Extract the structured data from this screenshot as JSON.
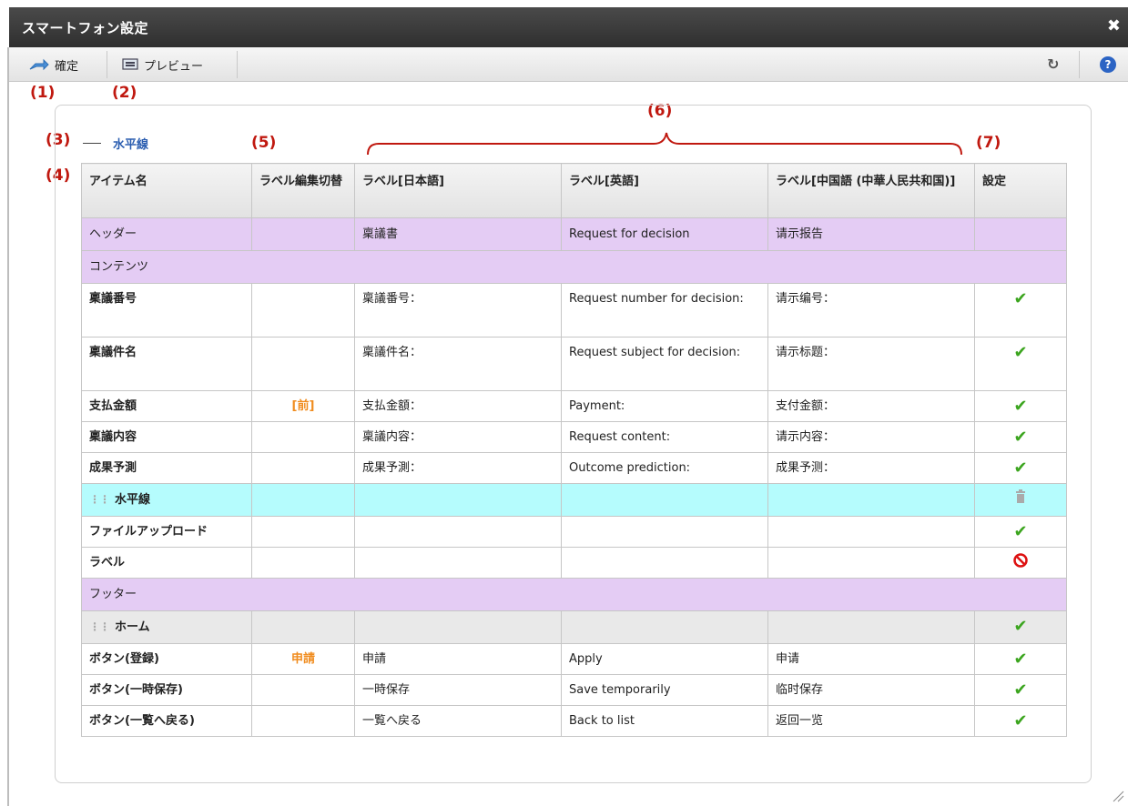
{
  "window": {
    "title": "スマートフォン設定"
  },
  "toolbar": {
    "confirm_label": "確定",
    "preview_label": "プレビュー"
  },
  "annotations": {
    "a1": "(1)",
    "a2": "(2)",
    "a3": "(3)",
    "a4": "(4)",
    "a5": "(5)",
    "a6": "(6)",
    "a7": "(7)"
  },
  "horizontal_line_label": "水平線",
  "table": {
    "headers": [
      "アイテム名",
      "ラベル編集切替",
      "ラベル[日本語]",
      "ラベル[英語]",
      "ラベル[中国語 (中華人民共和国)]",
      "設定"
    ],
    "rows": [
      {
        "name": "ヘッダー",
        "toggle": "",
        "ja": "稟議書",
        "en": "Request for decision",
        "zh": "请示报告",
        "setting": ""
      },
      {
        "name": "コンテンツ"
      },
      {
        "name": "稟議番号",
        "toggle": "",
        "ja": "稟議番号：",
        "en": "Request number for decision:",
        "zh": "请示编号：",
        "setting": "check"
      },
      {
        "name": "稟議件名",
        "toggle": "",
        "ja": "稟議件名：",
        "en": "Request subject for decision:",
        "zh": "请示标题：",
        "setting": "check"
      },
      {
        "name": "支払金額",
        "toggle": "[前]",
        "ja": "支払金額：",
        "en": "Payment:",
        "zh": "支付金额：",
        "setting": "check"
      },
      {
        "name": "稟議内容",
        "toggle": "",
        "ja": "稟議内容：",
        "en": "Request content:",
        "zh": "请示内容：",
        "setting": "check"
      },
      {
        "name": "成果予測",
        "toggle": "",
        "ja": "成果予測：",
        "en": "Outcome prediction:",
        "zh": "成果予测：",
        "setting": "check"
      },
      {
        "name": "水平線",
        "toggle": "",
        "ja": "",
        "en": "",
        "zh": "",
        "setting": "trash"
      },
      {
        "name": "ファイルアップロード",
        "toggle": "",
        "ja": "",
        "en": "",
        "zh": "",
        "setting": "check"
      },
      {
        "name": "ラベル",
        "toggle": "",
        "ja": "",
        "en": "",
        "zh": "",
        "setting": "forbidden"
      },
      {
        "name": "フッター"
      },
      {
        "name": "ホーム",
        "toggle": "",
        "ja": "",
        "en": "",
        "zh": "",
        "setting": "check"
      },
      {
        "name": "ボタン(登録)",
        "toggle": "申請",
        "ja": "申請",
        "en": "Apply",
        "zh": "申请",
        "setting": "check"
      },
      {
        "name": "ボタン(一時保存)",
        "toggle": "",
        "ja": "一時保存",
        "en": "Save temporarily",
        "zh": "临时保存",
        "setting": "check"
      },
      {
        "name": "ボタン(一覧へ戻る)",
        "toggle": "",
        "ja": "一覧へ戻る",
        "en": "Back to list",
        "zh": "返回一览",
        "setting": "check"
      }
    ]
  },
  "colors": {
    "section_row": "#e4ccf4",
    "selected_row": "#b5fcfd",
    "annotation": "#c0180f",
    "toggle_text": "#f08c1e",
    "check": "#3ca51f"
  },
  "icons": {
    "confirm": "arrow-icon",
    "preview": "monitor-icon",
    "refresh": "refresh-icon",
    "help": "help-icon",
    "close": "close-icon",
    "check": "check-icon",
    "trash": "trash-icon",
    "forbidden": "forbidden-icon"
  }
}
